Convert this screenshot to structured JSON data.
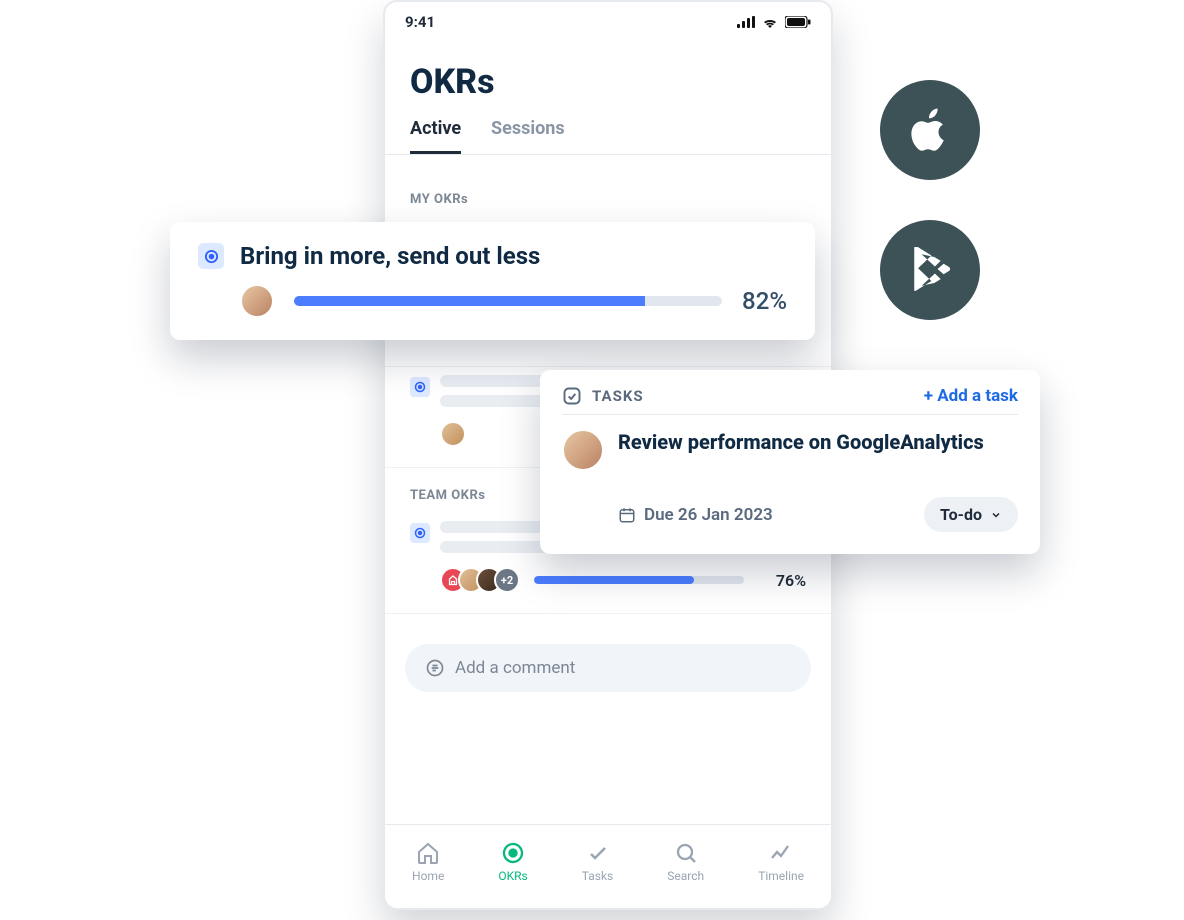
{
  "statusbar": {
    "time": "9:41"
  },
  "header": {
    "title": "OKRs",
    "tabs": {
      "active": "Active",
      "sessions": "Sessions"
    }
  },
  "sections": {
    "my": "MY OKRs",
    "team": "TEAM OKRs"
  },
  "team_okr": {
    "progress_pct": 76,
    "progress_label": "76%",
    "extra_count": "+2"
  },
  "comment": {
    "placeholder": "Add a comment"
  },
  "nav": {
    "home": "Home",
    "okrs": "OKRs",
    "tasks": "Tasks",
    "search": "Search",
    "timeline": "Timeline"
  },
  "okr_card": {
    "title": "Bring in more, send out less",
    "progress_pct": 82,
    "progress_label": "82%"
  },
  "task_card": {
    "section": "TASKS",
    "add_label": "+ Add a task",
    "title": "Review performance on GoogleAnalytics",
    "due": "Due 26 Jan 2023",
    "status": "To-do"
  },
  "colors": {
    "accent_blue": "#4c7dff",
    "accent_green": "#06b87c",
    "link_blue": "#1d6ae5"
  }
}
